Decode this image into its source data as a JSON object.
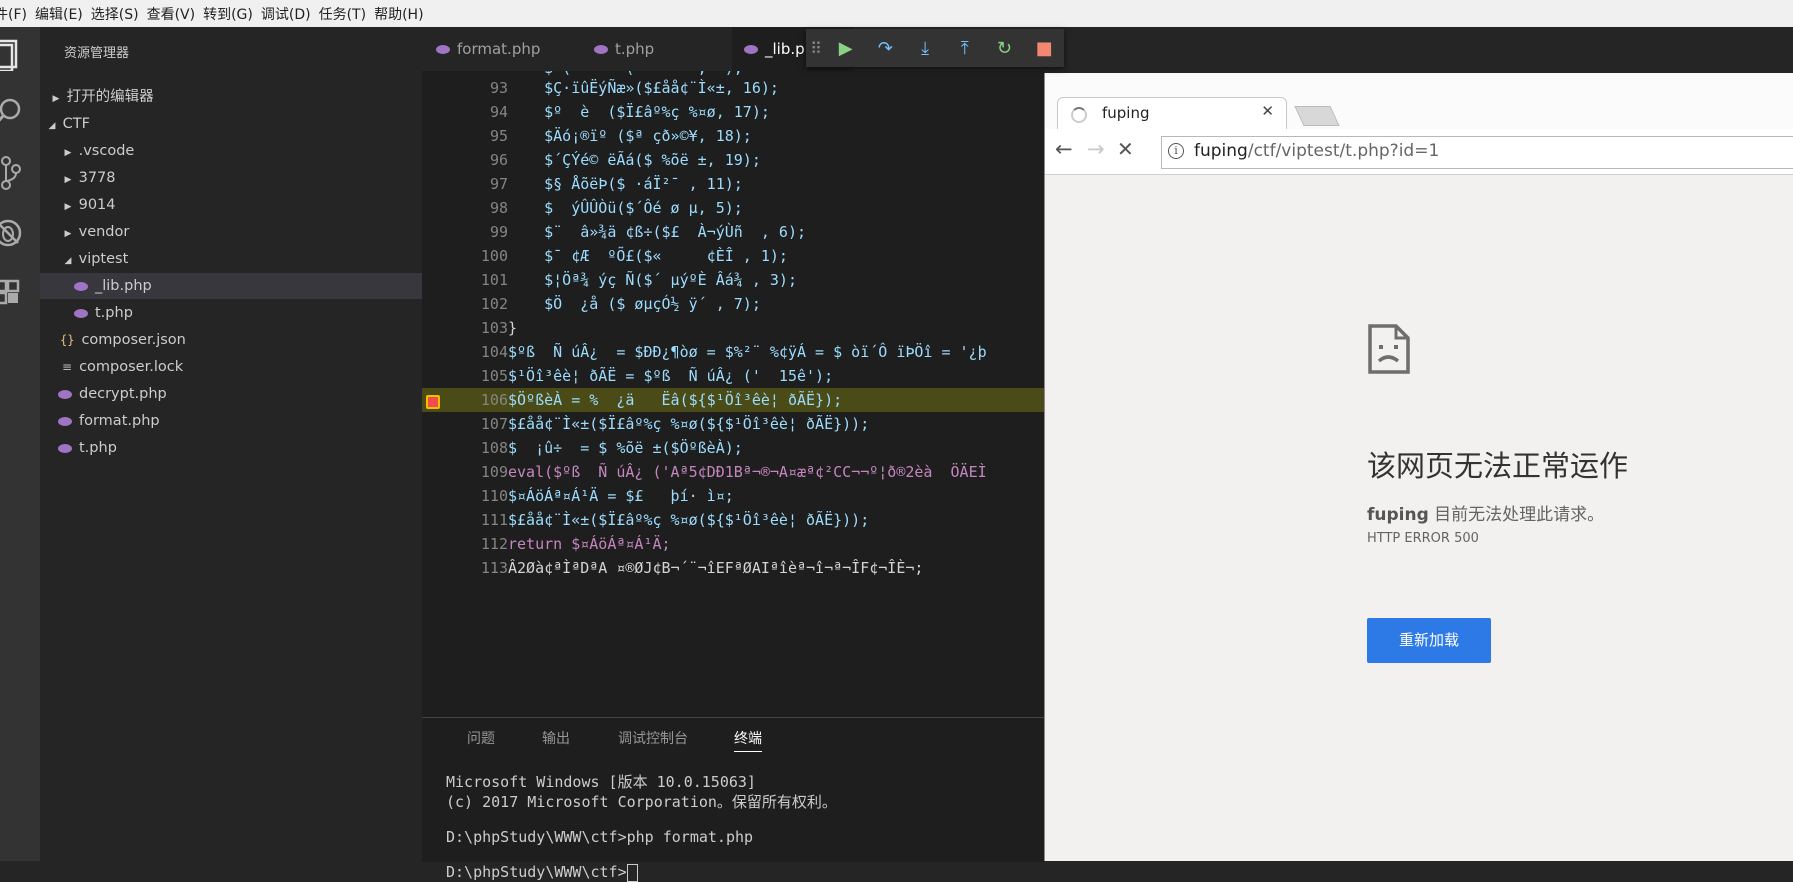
{
  "menubar": [
    "件(F)",
    "编辑(E)",
    "选择(S)",
    "查看(V)",
    "转到(G)",
    "调试(D)",
    "任务(T)",
    "帮助(H)"
  ],
  "sidebar": {
    "title": "资源管理器",
    "open_editors": "打开的编辑器",
    "root": "CTF",
    "items": [
      ".vscode",
      "3778",
      "9014",
      "vendor",
      "viptest",
      "_lib.php",
      "t.php",
      "composer.json",
      "composer.lock",
      "decrypt.php",
      "format.php",
      "t.php"
    ]
  },
  "tabs": [
    "format.php",
    "t.php",
    "_lib.p"
  ],
  "code": {
    "lines": [
      {
        "n": "93",
        "t": "    $Ç·ïûËýÑæ»($£åå¢¨Ì«±, 16);"
      },
      {
        "n": "94",
        "t": "    $º  è  ($Ï£âº%ç %¤ø, 17);"
      },
      {
        "n": "95",
        "t": "    $Äó¡®ïº ($ª çð»©¥, 18);"
      },
      {
        "n": "96",
        "t": "    $´ÇÝé© ëÃá($ %õë ±, 19);"
      },
      {
        "n": "97",
        "t": "    $§ ÅõëÞ($ ·áÏ²¯ , 11);"
      },
      {
        "n": "98",
        "t": "    $  ýÛÛÒü($´Ôé ø µ, 5);"
      },
      {
        "n": "99",
        "t": "    $¨  â»¾ä ¢ß÷($£  À¬ýÙñ  , 6);"
      },
      {
        "n": "100",
        "t": "    $¯ ¢Æ  ºÕ£($«     ¢ÈÎ , 1);"
      },
      {
        "n": "101",
        "t": "    $¦Öª¾ ýç Ñ($´ µýºÈ Âá¾ , 3);"
      },
      {
        "n": "102",
        "t": "    $Ö  ¿å ($ øµçÓ½ ÿ´ , 7);"
      },
      {
        "n": "103",
        "t": "}"
      },
      {
        "n": "104",
        "t": "$ºß  Ñ úÂ¿  = $ÐÐ¿¶òø = $%²¨ %¢ÿÁ = $ òï´Ô ïÞÖî = '¿þ"
      },
      {
        "n": "105",
        "t": "$¹Öî³êè¦ ðÃË = $ºß  Ñ úÂ¿ ('  15ê');"
      },
      {
        "n": "106",
        "t": "$ÖºßèÀ = %  ¿ä   Ëâ(${$¹Öî³êè¦ ðÃË});"
      },
      {
        "n": "107",
        "t": "$£åå¢¨Ì«±($Ï£âº%ç %¤ø(${$¹Öî³êè¦ ðÃË}));"
      },
      {
        "n": "108",
        "t": "$  ¡û÷  = $ %õë ±($ÖºßèÀ);"
      },
      {
        "n": "109",
        "t": "eval($ºß  Ñ úÂ¿ ('Aª5¢DÐ1Bª¬®¬A¤æª¢²CC¬¬º¦ð®2èà  ÖÄEÌ"
      },
      {
        "n": "110",
        "t": "$¤ÁöÁª¤Á¹Ä = $£   þí· ì¤;"
      },
      {
        "n": "111",
        "t": "$£åå¢¨Ì«±($Ï£âº%ç %¤ø(${$¹Öî³êè¦ ðÃË}));"
      },
      {
        "n": "112",
        "t": "return $¤ÁöÁª¤Á¹Ä;"
      },
      {
        "n": "113",
        "t": "Â2Øà¢ªÌªDªA ¤®ØJ¢B¬´¨¬îEFªØAIªîèª¬î¬ª¬ÎF¢¬ÎÈ¬;"
      }
    ]
  },
  "panel": {
    "tabs": [
      "问题",
      "输出",
      "调试控制台",
      "终端"
    ],
    "terminal": {
      "l1": "Microsoft Windows [版本 10.0.15063]",
      "l2": "(c) 2017 Microsoft Corporation。保留所有权利。",
      "l3": "D:\\phpStudy\\WWW\\ctf>php format.php",
      "l4": "D:\\phpStudy\\WWW\\ctf>"
    }
  },
  "browser": {
    "tab_title": "fuping",
    "url_host": "fuping",
    "url_path": "/ctf/viptest/t.php?id=1",
    "error_title": "该网页无法正常运作",
    "error_host": "fuping",
    "error_desc": " 目前无法处理此请求。",
    "error_code": "HTTP ERROR 500",
    "reload_label": "重新加载"
  }
}
